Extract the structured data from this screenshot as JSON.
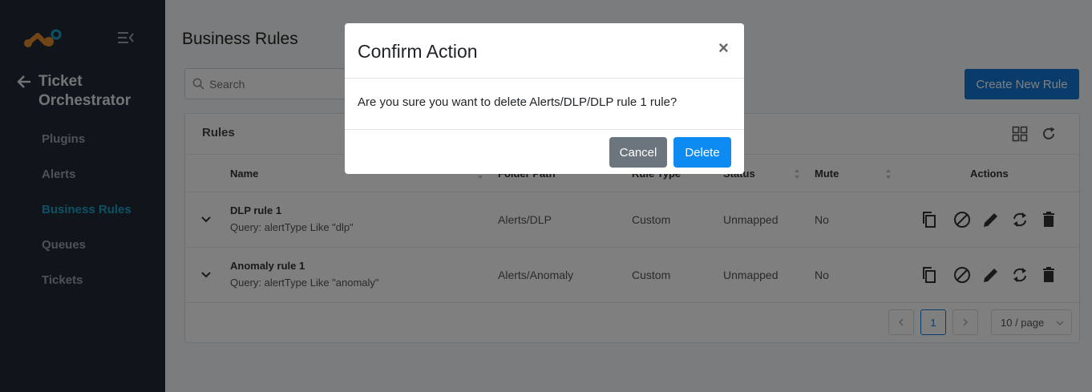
{
  "sidebar": {
    "app_title": "Ticket Orchestrator",
    "items": [
      {
        "label": "Plugins",
        "active": false
      },
      {
        "label": "Alerts",
        "active": false
      },
      {
        "label": "Business Rules",
        "active": true
      },
      {
        "label": "Queues",
        "active": false
      },
      {
        "label": "Tickets",
        "active": false
      }
    ]
  },
  "main": {
    "page_title": "Business Rules",
    "search_placeholder": "Search",
    "create_button": "Create New Rule",
    "card_title": "Rules",
    "columns": [
      "Name",
      "Folder Path",
      "Rule Type",
      "Status",
      "Mute",
      "Actions"
    ],
    "rows": [
      {
        "name": "DLP rule 1",
        "query": "Query: alertType Like \"dlp\"",
        "folder": "Alerts/DLP",
        "type": "Custom",
        "status": "Unmapped",
        "mute": "No"
      },
      {
        "name": "Anomaly rule 1",
        "query": "Query: alertType Like \"anomaly\"",
        "folder": "Alerts/Anomaly",
        "type": "Custom",
        "status": "Unmapped",
        "mute": "No"
      }
    ],
    "pagination": {
      "current_page": "1",
      "page_size": "10 / page"
    }
  },
  "modal": {
    "title": "Confirm Action",
    "close": "×",
    "message": "Are you sure you want to delete Alerts/DLP/DLP rule 1 rule?",
    "cancel_label": "Cancel",
    "delete_label": "Delete"
  },
  "colors": {
    "sidebar_bg": "#1f2a35",
    "accent": "#1fa2c9",
    "primary": "#1579d6",
    "delete_button": "#0d8bf2",
    "cancel_button": "#6c757d"
  }
}
